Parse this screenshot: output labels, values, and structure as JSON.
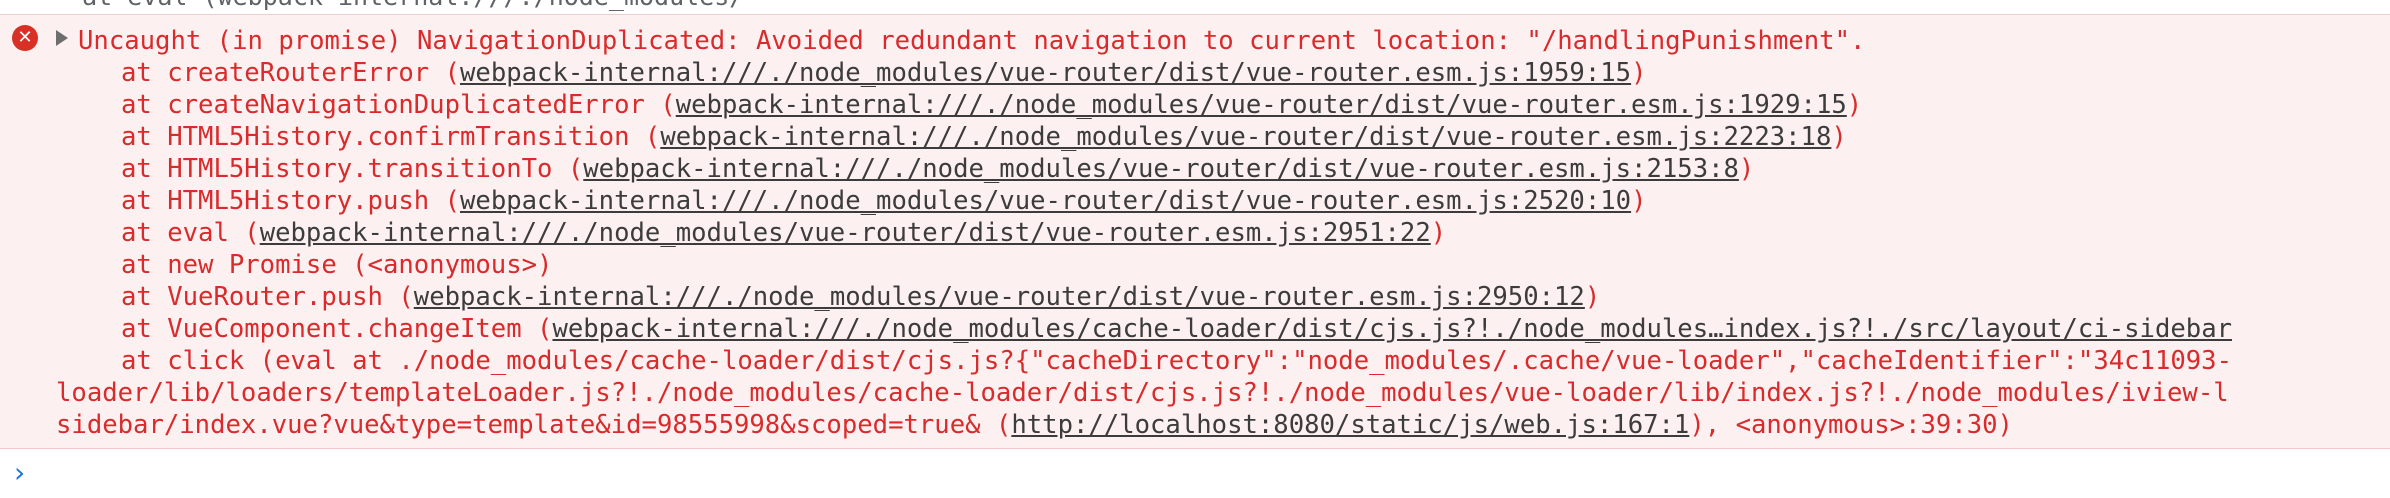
{
  "top_fragment": "  at eval (webpack-internal:///./node_modules/",
  "error": {
    "icon": "error-icon",
    "message": "Uncaught (in promise) NavigationDuplicated: Avoided redundant navigation to current location: \"/handlingPunishment\".",
    "frames": [
      {
        "prefix": "at createRouterError (",
        "link": "webpack-internal:///./node_modules/vue-router/dist/vue-router.esm.js:1959:15",
        "suffix": ")"
      },
      {
        "prefix": "at createNavigationDuplicatedError (",
        "link": "webpack-internal:///./node_modules/vue-router/dist/vue-router.esm.js:1929:15",
        "suffix": ")"
      },
      {
        "prefix": "at HTML5History.confirmTransition (",
        "link": "webpack-internal:///./node_modules/vue-router/dist/vue-router.esm.js:2223:18",
        "suffix": ")"
      },
      {
        "prefix": "at HTML5History.transitionTo (",
        "link": "webpack-internal:///./node_modules/vue-router/dist/vue-router.esm.js:2153:8",
        "suffix": ")"
      },
      {
        "prefix": "at HTML5History.push (",
        "link": "webpack-internal:///./node_modules/vue-router/dist/vue-router.esm.js:2520:10",
        "suffix": ")"
      },
      {
        "prefix": "at eval (",
        "link": "webpack-internal:///./node_modules/vue-router/dist/vue-router.esm.js:2951:22",
        "suffix": ")"
      },
      {
        "prefix": "at new Promise (<anonymous>)",
        "link": "",
        "suffix": ""
      },
      {
        "prefix": "at VueRouter.push (",
        "link": "webpack-internal:///./node_modules/vue-router/dist/vue-router.esm.js:2950:12",
        "suffix": ")"
      },
      {
        "prefix": "at VueComponent.changeItem (",
        "link": "webpack-internal:///./node_modules/cache-loader/dist/cjs.js?!./node_modules…index.js?!./src/layout/ci-sidebar",
        "suffix": ""
      },
      {
        "prefix": "at click (eval at ./node_modules/cache-loader/dist/cjs.js?{\"cacheDirectory\":\"node_modules/.cache/vue-loader\",\"cacheIdentifier\":\"34c11093-",
        "link": "",
        "suffix": ""
      }
    ],
    "wrap_lines": [
      {
        "prefix": "loader/lib/loaders/templateLoader.js?!./node_modules/cache-loader/dist/cjs.js?!./node_modules/vue-loader/lib/index.js?!./node_modules/iview-l",
        "link": "",
        "suffix": ""
      },
      {
        "prefix": "sidebar/index.vue?vue&type=template&id=98555998&scoped=true& (",
        "link": "http://localhost:8080/static/js/web.js:167:1",
        "suffix": "), <anonymous>:39:30)"
      }
    ]
  },
  "console": {
    "prompt_icon": "chevron-right-icon",
    "prompt_symbol": "›",
    "input_value": ""
  },
  "colors": {
    "error_text": "#d92b2b",
    "error_background": "#fdf0f0",
    "link_text": "#3c3c3c",
    "prompt_accent": "#1a73e8"
  }
}
